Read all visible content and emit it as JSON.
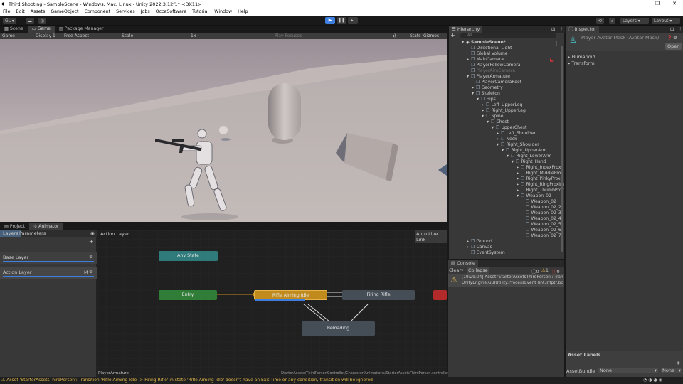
{
  "window": {
    "title": "Third Shooting - SampleScene - Windows, Mac, Linux - Unity 2022.3.12f1* <DX11>",
    "min": "–",
    "max": "❐",
    "close": "✕"
  },
  "menu": [
    "File",
    "Edit",
    "Assets",
    "GameObject",
    "Component",
    "Services",
    "Jobs",
    "OccaSoftware",
    "Tutorial",
    "Window",
    "Help"
  ],
  "toolbar": {
    "account": "GL ▾",
    "layers": "Layers",
    "layout": "Layout"
  },
  "game": {
    "tabs": [
      "Scene",
      "Game",
      "Package Manager"
    ],
    "display_mode": "Game",
    "display": "Display 1",
    "aspect": "Free Aspect",
    "scale_label": "Scale",
    "scale_value": "1x",
    "play_focused": "Play Focused",
    "stats": "Stats",
    "gizmos": "Gizmos"
  },
  "animator": {
    "tabs": [
      "Project",
      "Animator"
    ],
    "sub_tabs": [
      "Layers",
      "Parameters"
    ],
    "breadcrumb": "Action Layer",
    "auto_live_link": "Auto Live Link",
    "layers": [
      {
        "name": "Base Layer"
      },
      {
        "name": "Action Layer",
        "badge": "M"
      }
    ],
    "nodes": {
      "any_state": "Any State",
      "entry": "Entry",
      "rifle_aiming_idle": "Rifle Aiming Idle",
      "firing_rifle": "Firing Rifle",
      "reloading": "Reloading"
    },
    "footer_left": "PlayerArmature",
    "footer_right": "StarterAssets/ThirdPersonController/Character/Animations/StarterAssetsThirdPerson.controller"
  },
  "hierarchy": {
    "tab": "Hierarchy",
    "search": "All",
    "add": "+",
    "items": [
      {
        "label": "SampleScene*",
        "depth": 0,
        "arrow": "▾",
        "bold": true
      },
      {
        "label": "Directional Light",
        "depth": 1,
        "arrow": ""
      },
      {
        "label": "Global Volume",
        "depth": 1,
        "arrow": ""
      },
      {
        "label": "MainCamera",
        "depth": 1,
        "arrow": "▸"
      },
      {
        "label": "PlayerFollowCamera",
        "depth": 1,
        "arrow": ""
      },
      {
        "label": "PlayerAimCamera",
        "depth": 1,
        "arrow": "",
        "dim": true
      },
      {
        "label": "PlayerArmature",
        "depth": 1,
        "arrow": "▾"
      },
      {
        "label": "PlayerCameraRoot",
        "depth": 2,
        "arrow": ""
      },
      {
        "label": "Geometry",
        "depth": 2,
        "arrow": "▸"
      },
      {
        "label": "Skeleton",
        "depth": 2,
        "arrow": "▾"
      },
      {
        "label": "Hips",
        "depth": 3,
        "arrow": "▾"
      },
      {
        "label": "Left_UpperLeg",
        "depth": 4,
        "arrow": "▸"
      },
      {
        "label": "Right_UpperLeg",
        "depth": 4,
        "arrow": "▸"
      },
      {
        "label": "Spine",
        "depth": 4,
        "arrow": "▾"
      },
      {
        "label": "Chest",
        "depth": 5,
        "arrow": "▾"
      },
      {
        "label": "UpperChest",
        "depth": 6,
        "arrow": "▾"
      },
      {
        "label": "Left_Shoulder",
        "depth": 7,
        "arrow": "▸"
      },
      {
        "label": "Neck",
        "depth": 7,
        "arrow": "▸"
      },
      {
        "label": "Right_Shoulder",
        "depth": 7,
        "arrow": "▾"
      },
      {
        "label": "Right_UpperArm",
        "depth": 8,
        "arrow": "▾"
      },
      {
        "label": "Right_LowerArm",
        "depth": 9,
        "arrow": "▾"
      },
      {
        "label": "Right_Hand",
        "depth": 10,
        "arrow": "▾"
      },
      {
        "label": "Right_IndexProxi",
        "depth": 11,
        "arrow": "▸"
      },
      {
        "label": "Right_MiddlePro",
        "depth": 11,
        "arrow": "▸"
      },
      {
        "label": "Right_PinkyProxi",
        "depth": 11,
        "arrow": "▸"
      },
      {
        "label": "Right_RingProxim",
        "depth": 11,
        "arrow": "▸"
      },
      {
        "label": "Right_ThumbProx",
        "depth": 11,
        "arrow": "▸"
      },
      {
        "label": "Weapon_02",
        "depth": 11,
        "arrow": "▾"
      },
      {
        "label": "Weapon_02",
        "depth": 12,
        "arrow": ""
      },
      {
        "label": "Weapon_02_2",
        "depth": 12,
        "arrow": ""
      },
      {
        "label": "Weapon_02_3",
        "depth": 12,
        "arrow": ""
      },
      {
        "label": "Weapon_02_4",
        "depth": 12,
        "arrow": ""
      },
      {
        "label": "Weapon_02_5",
        "depth": 12,
        "arrow": ""
      },
      {
        "label": "Weapon_02_6",
        "depth": 12,
        "arrow": ""
      },
      {
        "label": "Weapon_02_7",
        "depth": 12,
        "arrow": ""
      },
      {
        "label": "Ground",
        "depth": 1,
        "arrow": "▸"
      },
      {
        "label": "Canvas",
        "depth": 1,
        "arrow": "▸"
      },
      {
        "label": "EventSystem",
        "depth": 1,
        "arrow": ""
      }
    ]
  },
  "console": {
    "tab": "Console",
    "clear": "Clear",
    "collapse": "Collapse",
    "counts": {
      "info": "0",
      "warn": "1",
      "error": "0"
    },
    "message_line1": "[19:29:04] Asset 'StarterAssetsThirdPerson': Transit",
    "message_line2": "UnityEngine.GUIUtility:ProcessEvent (int,intptr,bool"
  },
  "inspector": {
    "tab": "Inspector",
    "object_title": "Player Avatar Mask (Avatar Mask)",
    "open_button": "Open",
    "sections": [
      "Humanoid",
      "Transform"
    ],
    "asset_labels": "Asset Labels",
    "asset_bundle_label": "AssetBundle",
    "asset_bundle_value": "None",
    "asset_variant_value": "None"
  },
  "status": "Asset 'StarterAssetsThirdPerson': Transition 'Rifle Aiming Idle -> Firing Rifle' in state 'Rifle Aiming Idle' doesn't have an Exit Time or any condition, transition will be ignored",
  "colors": {
    "accent": "#3d7ede",
    "any_state": "#2f7a7a",
    "entry": "#2f7d36",
    "default_state": "#c08a1c",
    "state": "#454e57",
    "warning": "#e0b94a"
  }
}
